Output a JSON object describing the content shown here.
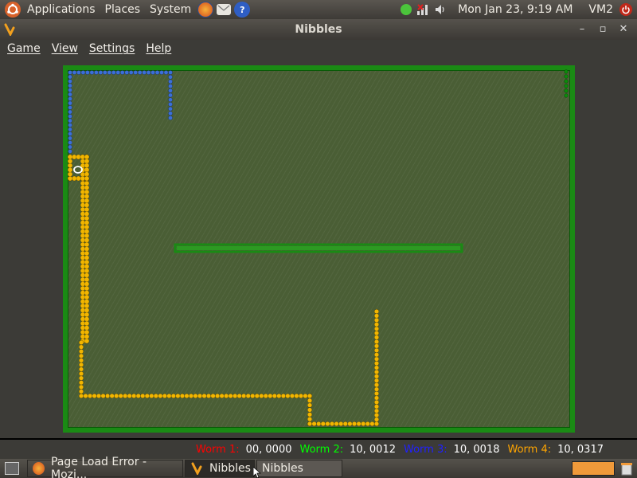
{
  "top_panel": {
    "menus": [
      "Applications",
      "Places",
      "System"
    ],
    "clock": "Mon Jan 23,  9:19 AM",
    "user": "VM2",
    "launcher_icons": [
      "firefox-icon",
      "mail-icon",
      "help-icon"
    ],
    "tray_icons": [
      "status-green-icon",
      "network-icon",
      "volume-icon"
    ]
  },
  "window": {
    "title": "Nibbles",
    "controls": [
      "minimize",
      "maximize",
      "close"
    ]
  },
  "menubar": {
    "items": [
      "Game",
      "View",
      "Settings",
      "Help"
    ]
  },
  "scores": [
    {
      "label": "Worm 1:",
      "value": "00, 0000",
      "color": "#ff0000"
    },
    {
      "label": "Worm 2:",
      "value": "10, 0012",
      "color": "#00ff00"
    },
    {
      "label": "Worm 3:",
      "value": "10, 0018",
      "color": "#0000ff"
    },
    {
      "label": "Worm 4:",
      "value": "10, 0317",
      "color": "#ffa500"
    }
  ],
  "taskbar": {
    "tasks": [
      {
        "label": "Page Load Error - Mozi...",
        "active": false
      },
      {
        "label": "Nibbles",
        "active": true
      },
      {
        "label": "Nibbles",
        "active": false
      }
    ]
  },
  "colors": {
    "wall": "#1a8a14",
    "arena": "#4a5e35",
    "worm_blue": "#3b6fd8",
    "worm_yellow": "#f2b600",
    "worm_green": "#0a8a0a"
  }
}
